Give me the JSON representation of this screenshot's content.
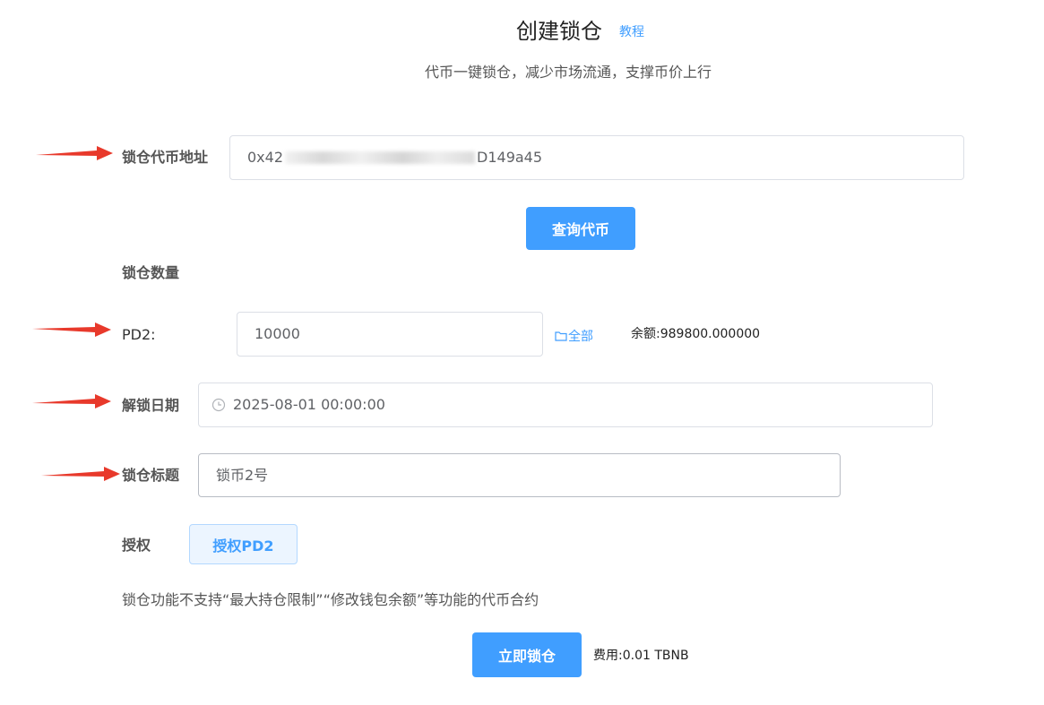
{
  "header": {
    "title": "创建锁仓",
    "tutorial_link": "教程",
    "subtitle": "代币一键锁仓，减少市场流通，支撑币价上行"
  },
  "form": {
    "token_address": {
      "label": "锁仓代币地址",
      "value_prefix": "0x42",
      "value_mid": "04D0BB8d011",
      "value_suffix": "D149a45"
    },
    "query_button": "查询代币",
    "lock_amount_label": "锁仓数量",
    "amount": {
      "token_label": "PD2:",
      "value": "10000",
      "all_link": "全部",
      "balance": "余额:989800.000000"
    },
    "unlock_date": {
      "label": "解锁日期",
      "value": "2025-08-01 00:00:00"
    },
    "lock_title": {
      "label": "锁仓标题",
      "value": "锁币2号"
    },
    "authorize": {
      "label": "授权",
      "button": "授权PD2"
    },
    "notice": "锁仓功能不支持“最大持仓限制”“修改钱包余额”等功能的代币合约",
    "submit_button": "立即锁仓",
    "fee": "费用:0.01 TBNB"
  },
  "icons": {
    "clock": "clock-icon",
    "folder": "folder-icon",
    "arrow": "red-arrow-icon"
  },
  "colors": {
    "primary": "#409eff",
    "arrow": "#e8392b"
  }
}
